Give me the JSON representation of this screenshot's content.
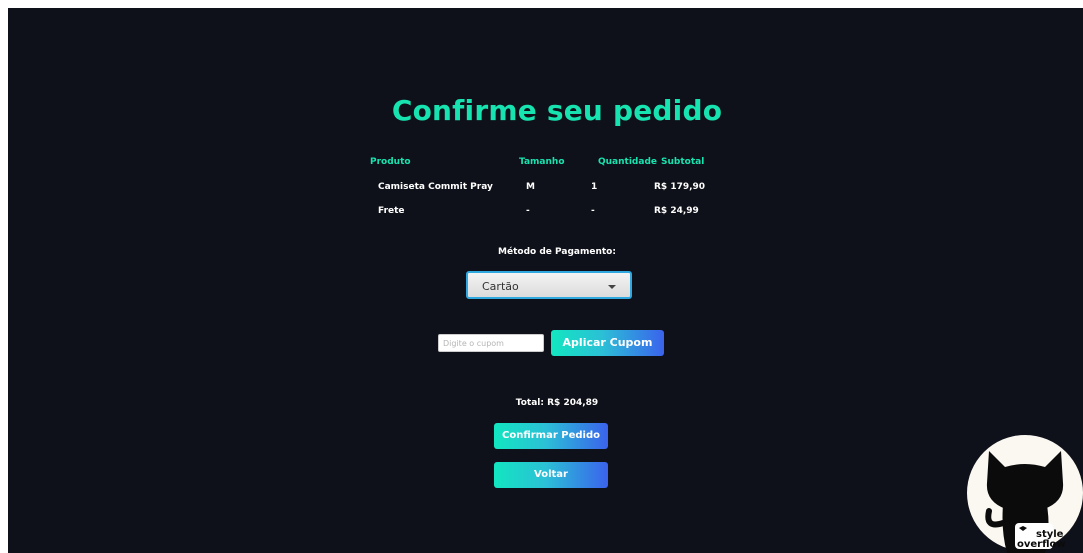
{
  "page": {
    "title": "Confirme seu pedido"
  },
  "table": {
    "headers": [
      "Produto",
      "Tamanho",
      "Quantidade",
      "Subtotal"
    ],
    "rows": [
      [
        "Camiseta Commit Pray",
        "M",
        "1",
        "R$ 179,90"
      ],
      [
        "Frete",
        "-",
        "-",
        "R$ 24,99"
      ]
    ]
  },
  "payment": {
    "label": "Método de Pagamento:",
    "selected": "Cartão"
  },
  "coupon": {
    "placeholder": "Digite o cupom",
    "value": "",
    "apply_label": "Aplicar Cupom"
  },
  "total": {
    "text": "Total: R$ 204,89"
  },
  "actions": {
    "confirm_label": "Confirmar Pedido",
    "back_label": "Voltar"
  },
  "logo": {
    "line1": "style",
    "line2": "overflow",
    "icon": "octocat-icon"
  },
  "colors": {
    "background": "#0e1119",
    "accent": "#17e3b0",
    "button_gradient_start": "#12e6c0",
    "button_gradient_end": "#3a63ec"
  }
}
